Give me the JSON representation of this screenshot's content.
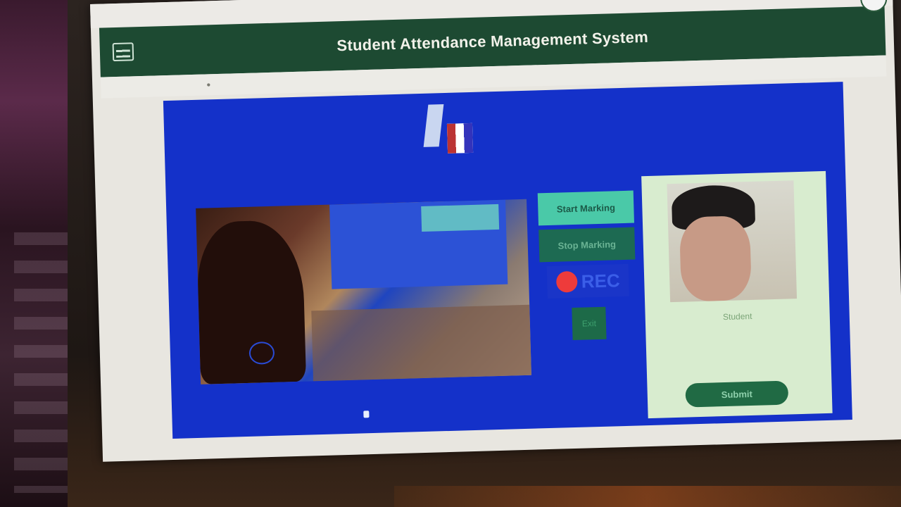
{
  "app": {
    "title": "Student Attendance Management System"
  },
  "controls": {
    "start_label": "Start Marking",
    "stop_label": "Stop Marking",
    "rec_label": "REC",
    "small_label": "Exit"
  },
  "profile": {
    "name": "Student",
    "submit_label": "Submit"
  },
  "colors": {
    "header": "#1d4a32",
    "panel": "#1431c9",
    "accent_green": "#4ac9a8",
    "rec_red": "#ee3b3b"
  }
}
